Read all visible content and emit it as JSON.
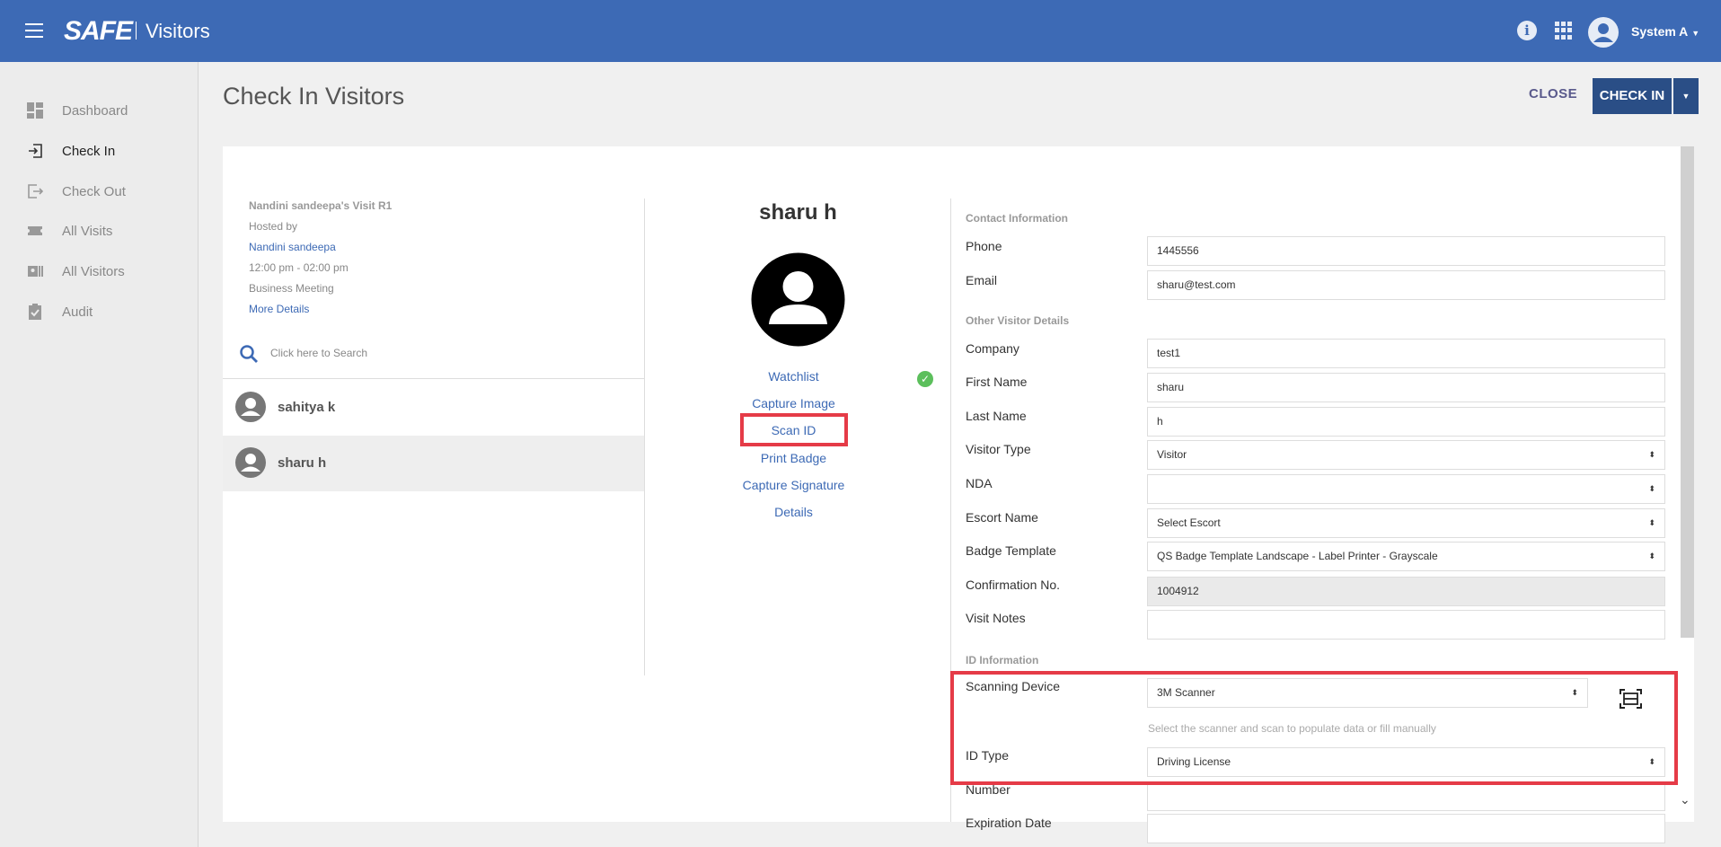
{
  "header": {
    "logo": "SAFE",
    "app_name": "Visitors",
    "user": "System A"
  },
  "sidebar": {
    "items": [
      {
        "label": "Dashboard",
        "icon": "dashboard-icon"
      },
      {
        "label": "Check In",
        "icon": "login-icon",
        "active": true
      },
      {
        "label": "Check Out",
        "icon": "logout-icon"
      },
      {
        "label": "All Visits",
        "icon": "ticket-icon"
      },
      {
        "label": "All Visitors",
        "icon": "id-card-icon"
      },
      {
        "label": "Audit",
        "icon": "clipboard-check-icon"
      }
    ]
  },
  "page": {
    "title": "Check In Visitors",
    "close_label": "CLOSE",
    "checkin_label": "CHECK IN"
  },
  "visit": {
    "title": "Nandini sandeepa's Visit R1",
    "hosted_by_label": "Hosted by",
    "host": "Nandini sandeepa",
    "time": "12:00 pm - 02:00 pm",
    "type": "Business Meeting",
    "more_details": "More Details"
  },
  "search": {
    "placeholder": "Click here to Search"
  },
  "visitors": [
    {
      "name": "sahitya k",
      "selected": false
    },
    {
      "name": "sharu h",
      "selected": true
    }
  ],
  "profile": {
    "name": "sharu h",
    "actions": [
      "Watchlist",
      "Capture Image",
      "Scan ID",
      "Print Badge",
      "Capture Signature",
      "Details"
    ]
  },
  "form": {
    "contact_section": "Contact Information",
    "other_section": "Other Visitor Details",
    "id_section": "ID Information",
    "fields": {
      "phone": {
        "label": "Phone",
        "value": "1445556"
      },
      "email": {
        "label": "Email",
        "value": "sharu@test.com"
      },
      "company": {
        "label": "Company",
        "value": "test1"
      },
      "first_name": {
        "label": "First Name",
        "value": "sharu"
      },
      "last_name": {
        "label": "Last Name",
        "value": "h"
      },
      "visitor_type": {
        "label": "Visitor Type",
        "value": "Visitor"
      },
      "nda": {
        "label": "NDA",
        "value": ""
      },
      "escort_name": {
        "label": "Escort Name",
        "value": "Select Escort"
      },
      "badge_template": {
        "label": "Badge Template",
        "value": "QS Badge Template Landscape - Label Printer - Grayscale"
      },
      "confirmation_no": {
        "label": "Confirmation No.",
        "value": "1004912"
      },
      "visit_notes": {
        "label": "Visit Notes",
        "value": ""
      },
      "scanning_device": {
        "label": "Scanning Device",
        "value": "3M Scanner"
      },
      "scan_hint": "Select the scanner and scan to populate data or fill manually",
      "id_type": {
        "label": "ID Type",
        "value": "Driving License"
      },
      "number": {
        "label": "Number",
        "value": ""
      },
      "expiration_date": {
        "label": "Expiration Date",
        "value": ""
      }
    }
  },
  "colors": {
    "topbar": "#3d6ab5",
    "button": "#2a4e86",
    "highlight": "#e53b47",
    "link": "#3d6ab5"
  }
}
